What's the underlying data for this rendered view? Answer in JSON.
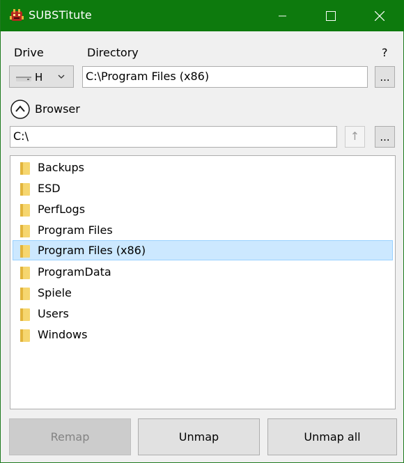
{
  "window": {
    "title": "SUBSTitute",
    "accent": "#0d7a0d",
    "icons": {
      "app": "app-icon",
      "minimize": "minimize-icon",
      "maximize": "maximize-icon",
      "close": "close-icon"
    }
  },
  "labels": {
    "drive": "Drive",
    "directory": "Directory",
    "help": "?",
    "browser": "Browser"
  },
  "drive": {
    "letter": "H"
  },
  "directory": {
    "value": "C:\\Program Files (x86)",
    "browse_label": "..."
  },
  "browser": {
    "path": "C:\\",
    "up_label": "↑",
    "browse_label": "...",
    "items": [
      {
        "label": "Backups",
        "selected": false
      },
      {
        "label": "ESD",
        "selected": false
      },
      {
        "label": "PerfLogs",
        "selected": false
      },
      {
        "label": "Program Files",
        "selected": false
      },
      {
        "label": "Program Files (x86)",
        "selected": true
      },
      {
        "label": "ProgramData",
        "selected": false
      },
      {
        "label": "Spiele",
        "selected": false
      },
      {
        "label": "Users",
        "selected": false
      },
      {
        "label": "Windows",
        "selected": false
      }
    ]
  },
  "buttons": {
    "remap": "Remap",
    "unmap": "Unmap",
    "unmap_all": "Unmap all"
  }
}
